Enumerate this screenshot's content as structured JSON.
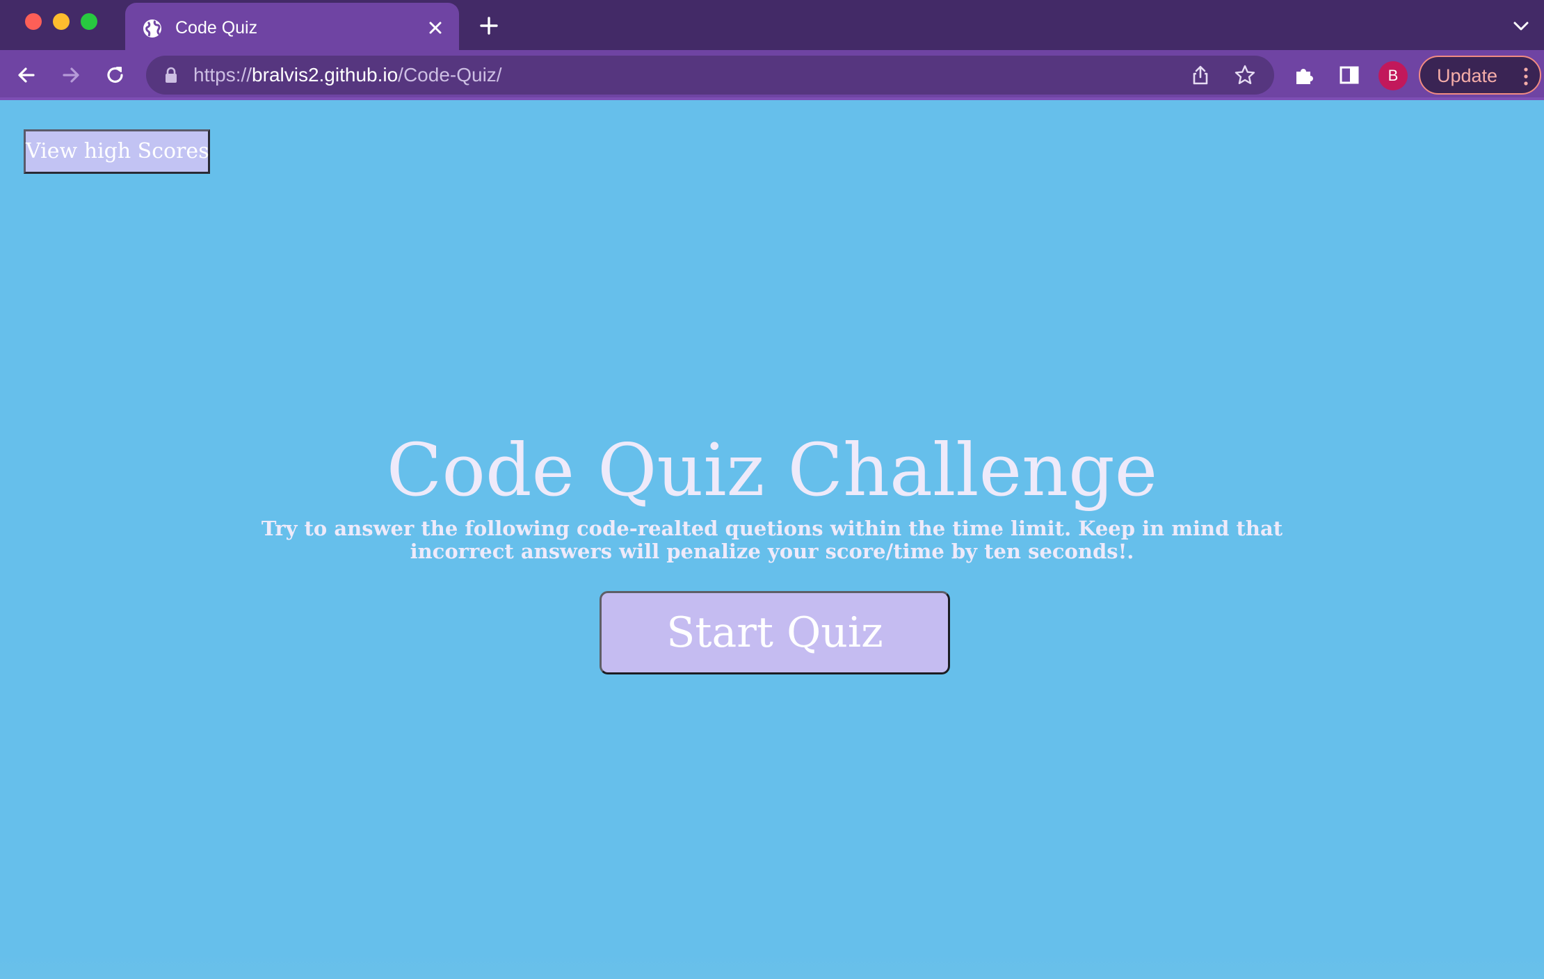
{
  "browser": {
    "tab": {
      "title": "Code Quiz"
    },
    "address_bar": {
      "scheme": "https://",
      "host": "bralvis2.github.io",
      "path": "/Code-Quiz/"
    },
    "profile_initial": "B",
    "update_label": "Update",
    "icons": {
      "favicon": "globe-icon",
      "tab_close": "close-icon",
      "new_tab": "plus-icon",
      "tab_search": "chevron-down-icon",
      "back": "arrow-left-icon",
      "forward": "arrow-right-icon",
      "reload": "reload-icon",
      "lock": "lock-icon",
      "share": "share-icon",
      "bookmark": "star-icon",
      "extensions": "puzzle-icon",
      "side_panel": "side-panel-icon",
      "menu": "kebab-menu-icon"
    }
  },
  "page": {
    "high_scores_label": "View high Scores",
    "title": "Code Quiz Challenge",
    "description": "Try to answer the following code-realted quetions within the time limit. Keep in mind that incorrect answers will penalize your score/time by ten seconds!.",
    "start_label": "Start Quiz"
  },
  "colors": {
    "page_background": "#66bfeb",
    "button_background": "#c5bcf1",
    "text": "#eeeafa",
    "chrome_frame": "#432a67",
    "chrome_toolbar": "#6f44a3",
    "avatar": "#c2185b",
    "update_accent": "#f28b82"
  }
}
